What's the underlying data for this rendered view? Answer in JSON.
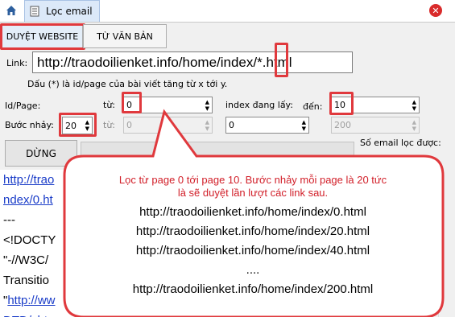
{
  "window": {
    "tab_label": "Lọc email",
    "home_icon": "home-icon",
    "close_icon": "close-icon"
  },
  "subtabs": [
    {
      "label": "DUYỆT WEBSITE"
    },
    {
      "label": "TỪ VĂN BẢN"
    }
  ],
  "link": {
    "label": "Link:",
    "value": "http://traodoilienket.info/home/index/*.html",
    "hint": "Dấu (*) là id/page của bài viết tăng từ x tới y."
  },
  "idpage": {
    "label": "Id/Page:",
    "from_label": "từ:",
    "from_value": "0",
    "current_label": "index đang lấy:",
    "to_label": "đến:",
    "to_value": "10"
  },
  "step": {
    "label": "Bước nhảy:",
    "value": "20",
    "from_label": "từ:",
    "from_value": "0",
    "current_value": "0",
    "to_value": "200"
  },
  "status": {
    "email_count_label": "Số email lọc được:"
  },
  "buttons": {
    "stop": "DỪNG"
  },
  "output": {
    "lines": [
      "http://trao",
      "ndex/0.ht",
      "---",
      "<!DOCTY",
      "\"-//W3C/",
      "Transitio",
      "\"http://ww",
      "DTD/xht"
    ]
  },
  "callout": {
    "line1": "Lọc từ page 0 tới page 10. Bước nhảy mỗi page là 20 tức",
    "line2": "là sẽ duyệt lần lượt các link sau.",
    "links": [
      "http://traodoilienket.info/home/index/0.html",
      "http://traodoilienket.info/home/index/20.html",
      "http://traodoilienket.info/home/index/40.html",
      "....",
      "http://traodoilienket.info/home/index/200.html"
    ]
  },
  "colors": {
    "annotation_red": "#e0393d",
    "callout_text_red": "#d2202a",
    "callout_fill": "#ffffff"
  }
}
